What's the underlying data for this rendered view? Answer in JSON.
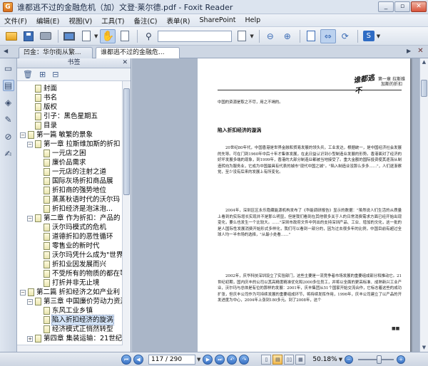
{
  "window": {
    "title": "谁都逃不过的金融危机（加）文登·莱尔德.pdf - Foxit Reader",
    "app_icon": "G",
    "controls": [
      "_",
      "▫",
      "✕"
    ]
  },
  "menu": [
    "文件(F)",
    "编辑(E)",
    "视图(V)",
    "工具(T)",
    "备注(C)",
    "表单(R)",
    "SharePoint",
    "Help"
  ],
  "toolbar": {
    "icons": [
      "open-folder-icon",
      "save-icon",
      "print-icon",
      "fullscreen-icon",
      "page-icon",
      "hand-tool-icon",
      "select-text-icon",
      "find-icon",
      "fit-page-icon",
      "fit-width-icon",
      "rotate-icon",
      "sharepoint-icon"
    ],
    "search_placeholder": ""
  },
  "tabs": [
    {
      "label": "凹金：华尔街从繁...",
      "active": false
    },
    {
      "label": "谁都逃不过的金融危...",
      "active": true
    }
  ],
  "bookmarks_panel": {
    "header": "书签",
    "items": [
      {
        "label": "封面",
        "level": 1,
        "expand": ""
      },
      {
        "label": "书名",
        "level": 1,
        "expand": ""
      },
      {
        "label": "版权",
        "level": 1,
        "expand": ""
      },
      {
        "label": "引子：黑色星期五",
        "level": 1,
        "expand": ""
      },
      {
        "label": "目录",
        "level": 1,
        "expand": ""
      },
      {
        "label": "第一篇  敏繁的景象",
        "level": 0,
        "expand": "−"
      },
      {
        "label": "第一章  拉斯维加斯的折扣",
        "level": 1,
        "expand": "−"
      },
      {
        "label": "一元店之困",
        "level": 2,
        "expand": ""
      },
      {
        "label": "廉价品需求",
        "level": 2,
        "expand": ""
      },
      {
        "label": "一元店的注射之道",
        "level": 2,
        "expand": ""
      },
      {
        "label": "国际灰场折扣商品展",
        "level": 2,
        "expand": ""
      },
      {
        "label": "折扣商的强势地位",
        "level": 2,
        "expand": ""
      },
      {
        "label": "蒸蒸秋语时代的沃尔玛",
        "level": 2,
        "expand": ""
      },
      {
        "label": "折扣经济是泡沫泡...",
        "level": 2,
        "expand": ""
      },
      {
        "label": "第二章  作为折扣：产品的",
        "level": 1,
        "expand": "−"
      },
      {
        "label": "沃尔玛模式的危机",
        "level": 2,
        "expand": ""
      },
      {
        "label": "道德折扣的恶性循环",
        "level": 2,
        "expand": ""
      },
      {
        "label": "零售业的新时代",
        "level": 2,
        "expand": ""
      },
      {
        "label": "沃尔玛凭什么成为\"世界",
        "level": 2,
        "expand": ""
      },
      {
        "label": "折扣业因发展而兴",
        "level": 2,
        "expand": ""
      },
      {
        "label": "不受所有的物质的都在等",
        "level": 2,
        "expand": ""
      },
      {
        "label": "打折并非无止境",
        "level": 2,
        "expand": ""
      },
      {
        "label": "第二篇  折扣经济之如产业利",
        "level": 0,
        "expand": "−"
      },
      {
        "label": "第三章  中国廉价劳动力资源",
        "level": 1,
        "expand": "−"
      },
      {
        "label": "东风工业乡镇",
        "level": 2,
        "expand": ""
      },
      {
        "label": "陷入折扣经济的旋涡",
        "level": 2,
        "expand": ""
      },
      {
        "label": "经济模式正悄然转型",
        "level": 2,
        "expand": ""
      },
      {
        "label": "第四章  集装运输：21世纪",
        "level": 1,
        "expand": "+"
      }
    ],
    "selected_index": 25
  },
  "document": {
    "seal_text": "谁都逃不",
    "header_right": "第一章 拉斯维加斯的折扣",
    "para_top": "中国的资源是取之不尽，用之不竭的。",
    "heading": "陷入折扣经济的漩涡",
    "paragraphs": [
      "20世纪80年代，中国香港是世界金融和贸易发展的领头兵，工业发达，根据统一，是中国经济社会发展的先导。可在门到1960年中后十年才集体发展，在此日益认识到小型制造业发展的形势。香港面对了经济的好坏发展多端的现象，到1999年，香港的大部分制造业都被当地接受了。重大金额的国际投资使其逐渐从制造转向为服务业，它成为中国最具有代表的城市\"现代中国之城\"。\"陷入制造业没那么多多……\"，人们逐渐察觉，至少没有后来的发展上有所变化。",
      "2004年，深圳区区永乐隐藏能源机构发布了《华能调研报告》显示的数据：\"虽然说人们生活的从质量上看到的实际增长实现并不是那么明显，但是我们看到在其他很多关于人的日常消费需求方面已经开始出现变化，要么也发生一个比较大。……\"深圳市政府文件中列出的支持深圳产品、工业、增加的文化，这一批的是人国际性发展消费开始形式多样化，我们可以看到一部分的，因为过去很多年的比例，中国目前有超过全球人均一半市场的选择，\"从最小处看……\"",
      "2002年，庆华科技深圳设立了实验部门，这些主要是一流竞争者市场发展的重要组成部分和推动它。21世纪初期，国内庆丰的公司以其高精度精准优化和2000多位员工，并将以全面的更高标准、成熟新兴工业产业，沃尔玛与总体是有位的那样的发展：2001年，庆丰集团从51个国家开始交流合作，它标志着这些的成功扩张，但庆丰公司作为可持续发展的重要组成环节，将持续发挥作用，1996年，庆丰公司建立了以产品的开发进度为中心，2004年上涨到180多元。到了2008年，这个"
    ],
    "end_mark": "■■"
  },
  "statusbar": {
    "page_display": "117 / 290",
    "zoom": "50.18%",
    "zoom_level": 0.6
  }
}
